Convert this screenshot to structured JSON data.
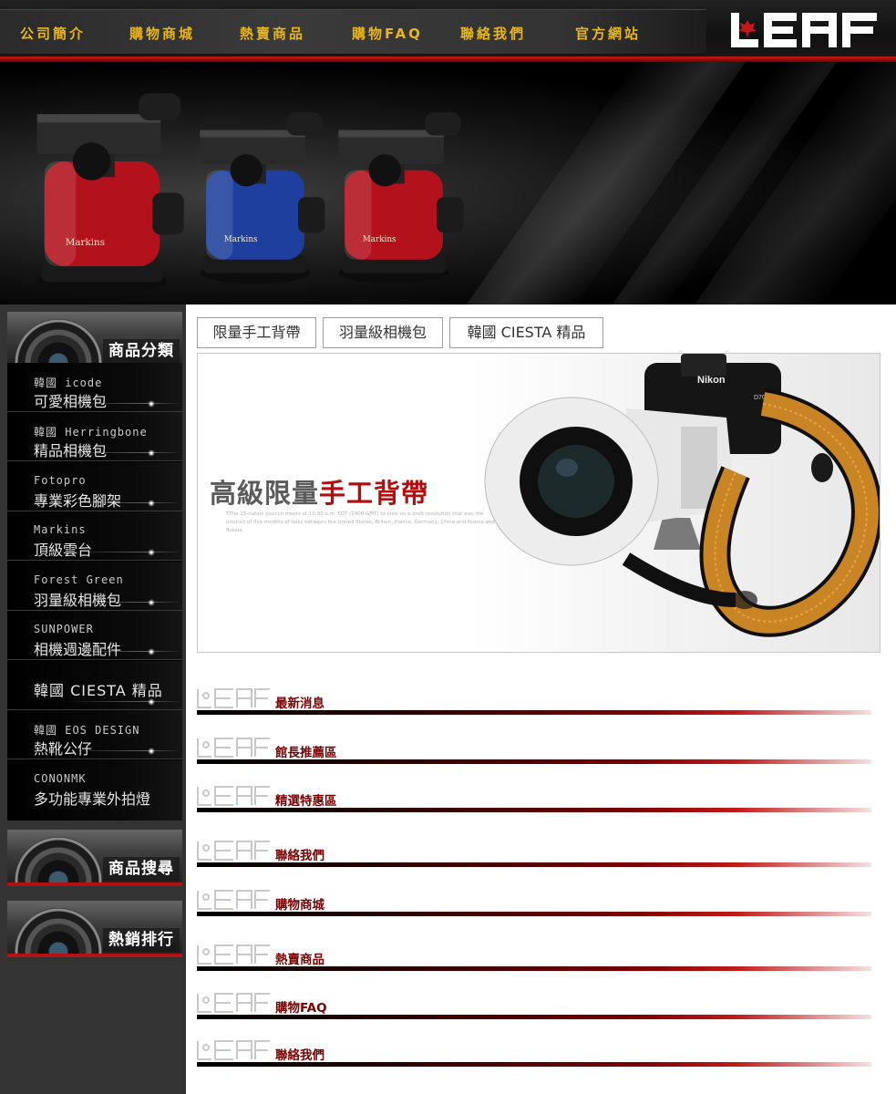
{
  "nav": {
    "items": [
      "公司簡介",
      "購物商城",
      "熱賣商品",
      "購物FAQ",
      "聯絡我們",
      "官方網站"
    ]
  },
  "logo": {
    "text": "LEAF"
  },
  "banner": {
    "products": [
      {
        "color": "#b3121c",
        "brand": "Markins"
      },
      {
        "color": "#1f3f9e",
        "brand": "Markins"
      },
      {
        "color": "#b3121c",
        "brand": "Markins"
      }
    ]
  },
  "sidebar": {
    "category_title": "商品分類",
    "categories": [
      {
        "en": "韓國 icode",
        "zh": "可愛相機包"
      },
      {
        "en": "韓國 Herringbone",
        "zh": "精品相機包"
      },
      {
        "en": "Fotopro",
        "zh": "專業彩色腳架"
      },
      {
        "en": "Markins",
        "zh": "頂級雲台"
      },
      {
        "en": "Forest Green",
        "zh": "羽量級相機包"
      },
      {
        "en": "SUNPOWER",
        "zh": "相機週邊配件"
      },
      {
        "en": "",
        "zh": "韓國 CIESTA 精品"
      },
      {
        "en": "韓國 EOS DESIGN",
        "zh": "熱靴公仔"
      },
      {
        "en": "CONONMK",
        "zh": "多功能專業外拍燈"
      }
    ],
    "search_title": "商品搜尋",
    "ranking_title": "熱銷排行"
  },
  "tabs": [
    "限量手工背帶",
    "羽量級相機包",
    "韓國 CIESTA 精品"
  ],
  "hero": {
    "title_gray": "高級限量",
    "title_red": "手工背帶",
    "small_text": "TThe 15-nation council meets at 10:00 a.m. EDT (1400 GMT) to vote on a draft resolution that was the product of five months of talks between the United States, Britain, France, Germany, China and Russia and Russia",
    "camera_brand": "Nikon",
    "camera_model": "D700"
  },
  "sections": [
    "最新消息",
    "館長推薦區",
    "精選特惠區",
    "聯絡我們",
    "購物商城",
    "熱賣商品",
    "購物FAQ",
    "聯絡我們"
  ],
  "colors": {
    "accent_red": "#b30d0d",
    "nav_gold": "#e8b61a",
    "section_label": "#7a0000"
  }
}
